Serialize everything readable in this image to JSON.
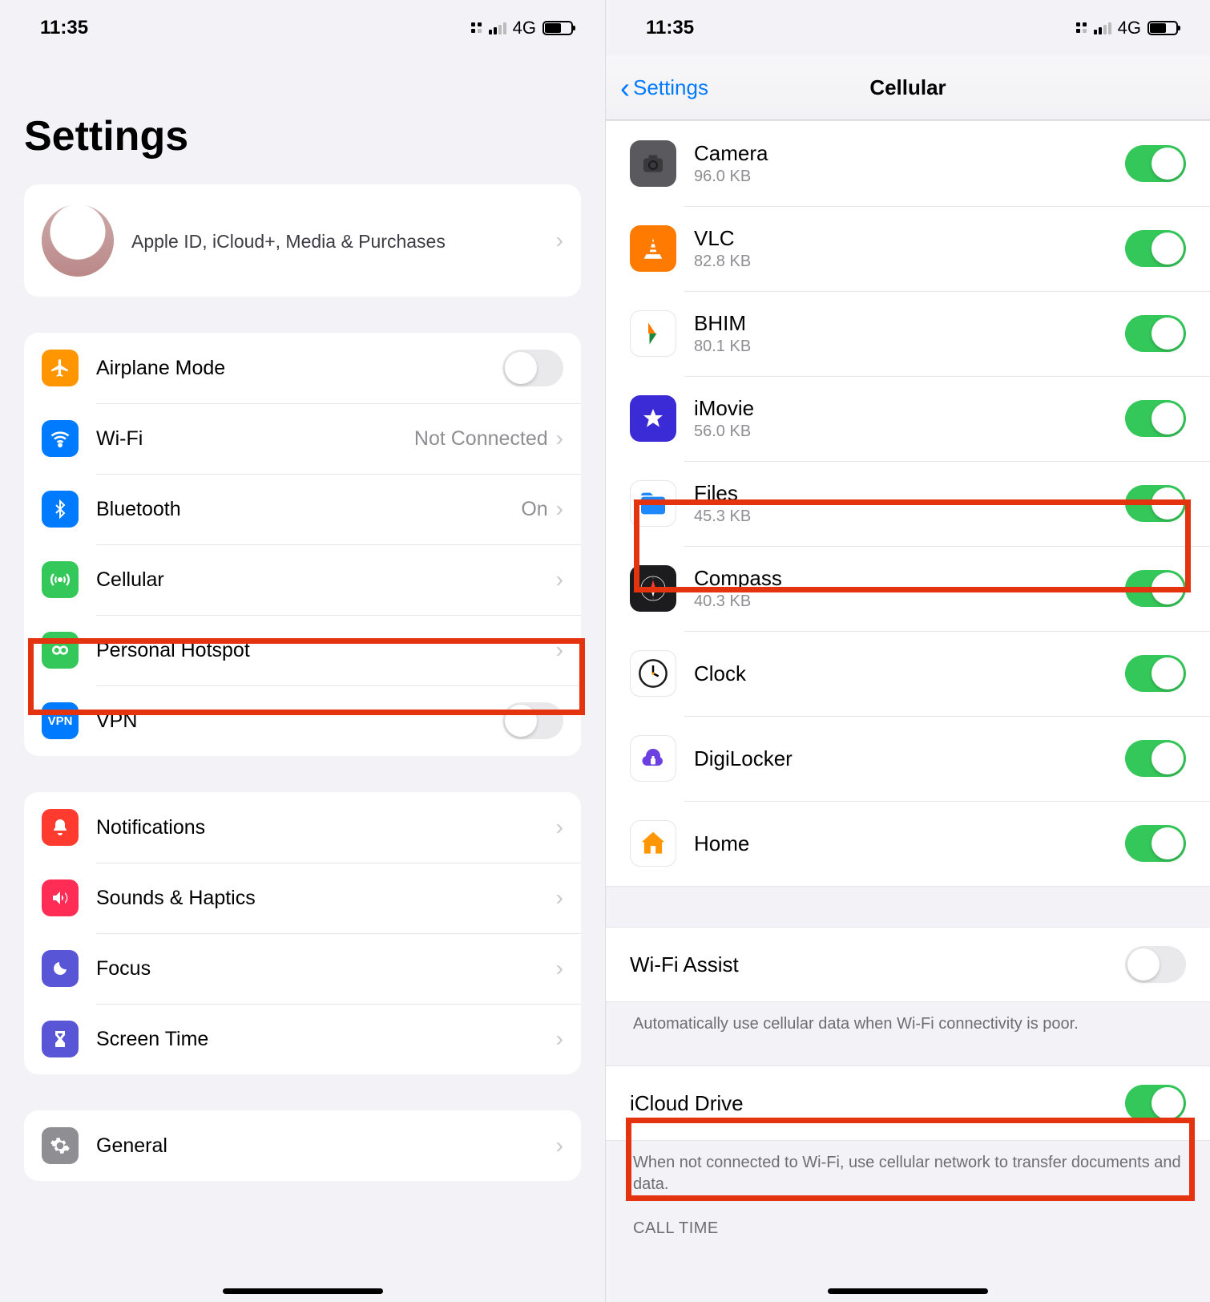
{
  "status": {
    "time": "11:35",
    "network": "4G"
  },
  "left": {
    "page_title": "Settings",
    "profile_subtitle": "Apple ID, iCloud+, Media & Purchases",
    "group1": {
      "airplane": {
        "label": "Airplane Mode",
        "on": false
      },
      "wifi": {
        "label": "Wi-Fi",
        "value": "Not Connected"
      },
      "bluetooth": {
        "label": "Bluetooth",
        "value": "On"
      },
      "cellular": {
        "label": "Cellular"
      },
      "hotspot": {
        "label": "Personal Hotspot"
      },
      "vpn": {
        "label": "VPN",
        "on": false
      }
    },
    "group2": {
      "notifications": {
        "label": "Notifications"
      },
      "sounds": {
        "label": "Sounds & Haptics"
      },
      "focus": {
        "label": "Focus"
      },
      "screentime": {
        "label": "Screen Time"
      }
    },
    "group3": {
      "general": {
        "label": "General"
      }
    }
  },
  "right": {
    "back_label": "Settings",
    "nav_title": "Cellular",
    "apps": [
      {
        "key": "camera",
        "name": "Camera",
        "size": "96.0 KB",
        "on": true,
        "color": "#59595e",
        "glyph": "camera"
      },
      {
        "key": "vlc",
        "name": "VLC",
        "size": "82.8 KB",
        "on": true,
        "color": "#ff7a00",
        "glyph": "vlc"
      },
      {
        "key": "bhim",
        "name": "BHIM",
        "size": "80.1 KB",
        "on": true,
        "color": "#ffffff",
        "glyph": "bhim"
      },
      {
        "key": "imovie",
        "name": "iMovie",
        "size": "56.0 KB",
        "on": true,
        "color": "#3a2bd6",
        "glyph": "imovie"
      },
      {
        "key": "files",
        "name": "Files",
        "size": "45.3 KB",
        "on": true,
        "color": "#ffffff",
        "glyph": "files"
      },
      {
        "key": "compass",
        "name": "Compass",
        "size": "40.3 KB",
        "on": true,
        "color": "#1c1c1e",
        "glyph": "compass"
      },
      {
        "key": "clock",
        "name": "Clock",
        "size": "",
        "on": true,
        "color": "#ffffff",
        "glyph": "clock"
      },
      {
        "key": "digilocker",
        "name": "DigiLocker",
        "size": "",
        "on": true,
        "color": "#ffffff",
        "glyph": "digilocker"
      },
      {
        "key": "home",
        "name": "Home",
        "size": "",
        "on": true,
        "color": "#ffffff",
        "glyph": "home"
      }
    ],
    "wifi_assist": {
      "label": "Wi-Fi Assist",
      "on": false,
      "footer": "Automatically use cellular data when Wi-Fi connectivity is poor."
    },
    "icloud_drive": {
      "label": "iCloud Drive",
      "on": true,
      "footer": "When not connected to Wi-Fi, use cellular network to transfer documents and data."
    },
    "call_time_header": "CALL TIME"
  }
}
